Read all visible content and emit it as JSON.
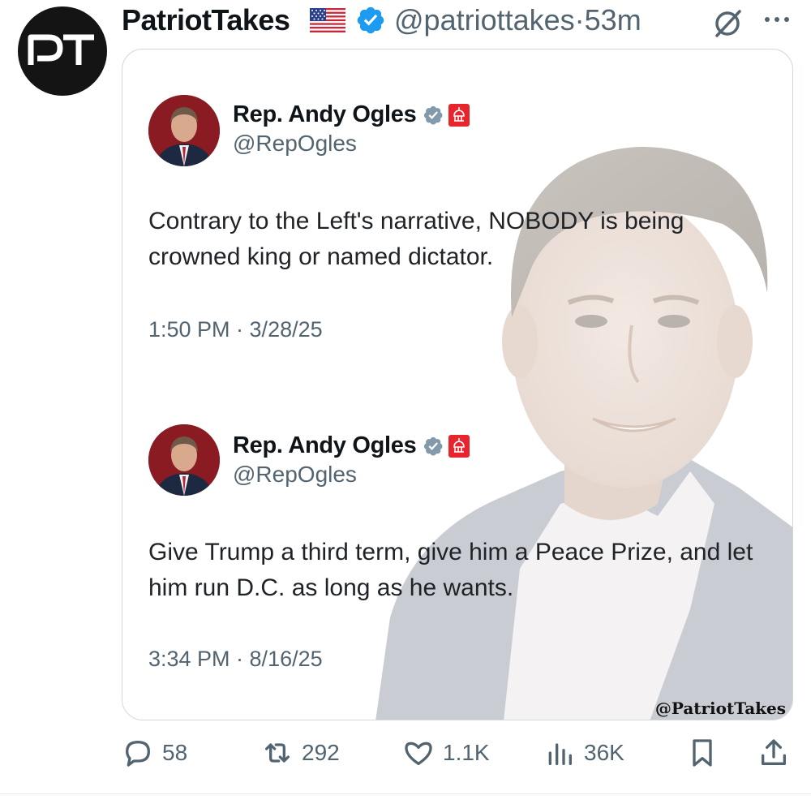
{
  "post": {
    "author_name": "PatriotTakes",
    "author_handle": "@patriottakes",
    "separator": "·",
    "time_ago": "53m",
    "avatar_initials": "PT"
  },
  "media": {
    "watermark": "@PatriotTakes",
    "quotes": [
      {
        "name": "Rep. Andy Ogles",
        "handle": "@RepOgles",
        "text": "Contrary to the Left's narrative, NOBODY is being crowned king or named dictator.",
        "timestamp": "1:50 PM · 3/28/25"
      },
      {
        "name": "Rep. Andy Ogles",
        "handle": "@RepOgles",
        "text": "Give Trump a third term, give him a Peace Prize, and let him run D.C. as long as he wants.",
        "timestamp": "3:34 PM · 8/16/25"
      }
    ]
  },
  "actions": {
    "replies": "58",
    "reposts": "292",
    "likes": "1.1K",
    "views": "36K"
  },
  "icons": {
    "verified": "verified-badge-icon",
    "flag": "us-flag-icon",
    "grok": "grok-icon",
    "more": "more-icon",
    "reply": "reply-icon",
    "repost": "repost-icon",
    "like": "heart-icon",
    "views": "views-icon",
    "bookmark": "bookmark-icon",
    "share": "share-icon"
  },
  "colors": {
    "verified_blue": "#1d9bf0",
    "secondary_text": "#536471",
    "congress_red": "#e8252c",
    "gray_badge": "#829aab"
  }
}
